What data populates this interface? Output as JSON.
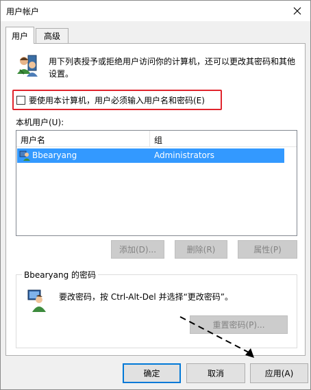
{
  "window": {
    "title": "用户帐户"
  },
  "tabs": [
    {
      "label": "用户"
    },
    {
      "label": "高级"
    }
  ],
  "description": "用下列表授予或拒绝用户访问你的计算机，还可以更改其密码和其他设置。",
  "require_login": {
    "label": "要使用本计算机，用户必须输入用户名和密码(E)",
    "checked": false
  },
  "local_users": {
    "label": "本机用户(U):",
    "columns": [
      "用户名",
      "组"
    ],
    "rows": [
      {
        "user": "Bbearyang",
        "group": "Administrators",
        "selected": true
      }
    ]
  },
  "list_buttons": {
    "add": "添加(D)...",
    "remove": "删除(R)",
    "properties": "属性(P)"
  },
  "password_group": {
    "title": "Bbearyang 的密码",
    "text": "要改密码，按 Ctrl-Alt-Del 并选择“更改密码”。",
    "reset": "重置密码(P)..."
  },
  "footer": {
    "ok": "确定",
    "cancel": "取消",
    "apply": "应用(A)"
  },
  "colors": {
    "selection": "#3399ff",
    "highlight_box": "#e0242c",
    "default_button": "#0078d7"
  }
}
